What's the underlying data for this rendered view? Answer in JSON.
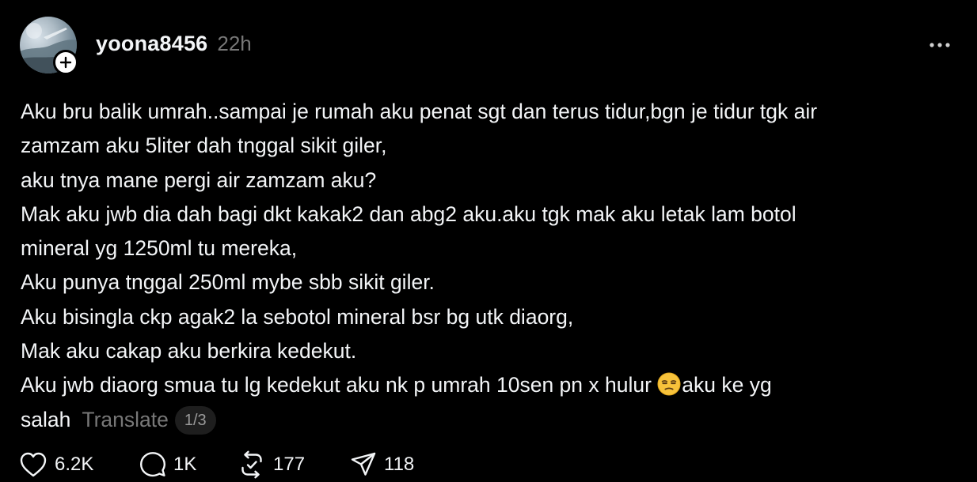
{
  "post": {
    "username": "yoona8456",
    "timestamp": "22h",
    "body_lines": [
      "Aku bru balik umrah..sampai je rumah aku penat sgt dan terus tidur,bgn je tidur tgk air",
      "zamzam aku 5liter dah tnggal sikit giler,",
      "aku tnya mane pergi air zamzam aku?",
      "Mak aku jwb dia dah bagi dkt kakak2 dan abg2 aku.aku tgk mak aku letak lam botol",
      "mineral yg 1250ml tu mereka,",
      "Aku punya tnggal 250ml mybe sbb sikit giler.",
      "Aku bisingla ckp agak2 la sebotol mineral bsr bg utk diaorg,",
      "Mak aku cakap aku berkira kedekut."
    ],
    "line9_before_emoji": "Aku jwb diaorg smua tu lg kedekut aku nk p umrah 10sen pn x hulur ",
    "line9_after_emoji": "aku ke yg",
    "line10_text": "salah",
    "translate_label": "Translate",
    "page_indicator": "1/3",
    "emoji_icon": "unamused-face-emoji"
  },
  "actions": {
    "likes": "6.2K",
    "comments": "1K",
    "reposts": "177",
    "shares": "118"
  },
  "icons": {
    "follow": "plus-icon",
    "more": "more-horizontal-icon",
    "like": "heart-icon",
    "comment": "comment-bubble-icon",
    "repost": "repost-icon",
    "share": "send-icon"
  },
  "colors": {
    "background": "#000000",
    "primary_text": "#f3f5f7",
    "secondary_text": "#777777"
  }
}
